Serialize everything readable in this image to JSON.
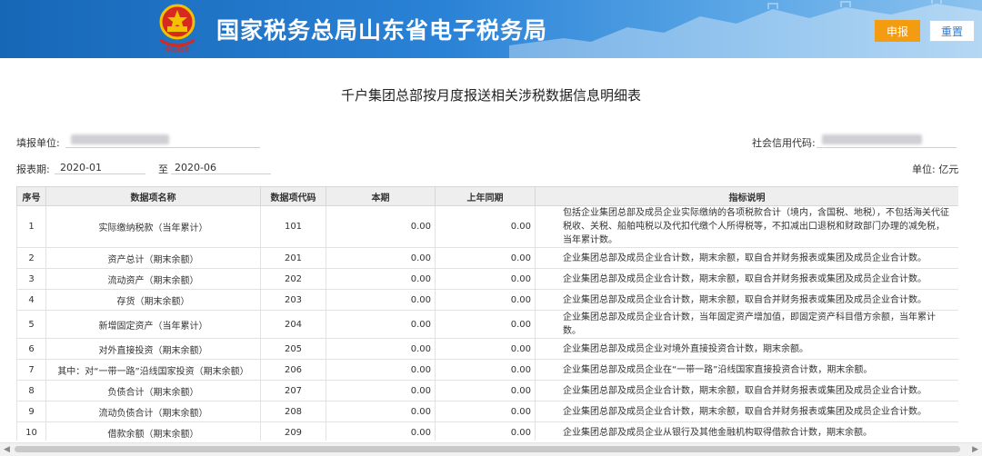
{
  "header": {
    "site_title": "国家税务总局山东省电子税务局",
    "submit_label": "申报",
    "reset_label": "重置"
  },
  "form": {
    "title": "千户集团总部按月度报送相关涉税数据信息明细表",
    "filler_label": "填报单位:",
    "credit_code_label": "社会信用代码:",
    "period_label": "报表期:",
    "period_start": "2020-01",
    "period_to": "至",
    "period_end": "2020-06",
    "unit_label": "单位: 亿元"
  },
  "table": {
    "headers": [
      "序号",
      "数据项名称",
      "数据项代码",
      "本期",
      "上年同期",
      "指标说明"
    ],
    "rows": [
      {
        "no": "1",
        "name": "实际缴纳税款（当年累计）",
        "code": "101",
        "cur": "0.00",
        "prev": "0.00",
        "desc": "包括企业集团总部及成员企业实际缴纳的各项税款合计（境内，含国税、地税），不包括海关代征税收、关税、船舶吨税以及代扣代缴个人所得税等，不扣减出口退税和财政部门办理的减免税，当年累计数。"
      },
      {
        "no": "2",
        "name": "资产总计（期末余额）",
        "code": "201",
        "cur": "0.00",
        "prev": "0.00",
        "desc": "企业集团总部及成员企业合计数，期末余额，取自合并财务报表或集团及成员企业合计数。"
      },
      {
        "no": "3",
        "name": "流动资产（期末余额）",
        "code": "202",
        "cur": "0.00",
        "prev": "0.00",
        "desc": "企业集团总部及成员企业合计数，期末余额，取自合并财务报表或集团及成员企业合计数。"
      },
      {
        "no": "4",
        "name": "存货（期末余额）",
        "code": "203",
        "cur": "0.00",
        "prev": "0.00",
        "desc": "企业集团总部及成员企业合计数，期末余额，取自合并财务报表或集团及成员企业合计数。"
      },
      {
        "no": "5",
        "name": "新增固定资产（当年累计）",
        "code": "204",
        "cur": "0.00",
        "prev": "0.00",
        "desc": "企业集团总部及成员企业合计数，当年固定资产增加值，即固定资产科目借方余额，当年累计数。"
      },
      {
        "no": "6",
        "name": "对外直接投资（期末余额）",
        "code": "205",
        "cur": "0.00",
        "prev": "0.00",
        "desc": "企业集团总部及成员企业对境外直接投资合计数，期末余额。"
      },
      {
        "no": "7",
        "name": "其中：对“一带一路”沿线国家投资（期末余额）",
        "code": "206",
        "cur": "0.00",
        "prev": "0.00",
        "desc": "企业集团总部及成员企业在“一带一路”沿线国家直接投资合计数，期末余额。"
      },
      {
        "no": "8",
        "name": "负债合计（期末余额）",
        "code": "207",
        "cur": "0.00",
        "prev": "0.00",
        "desc": "企业集团总部及成员企业合计数，期末余额，取自合并财务报表或集团及成员企业合计数。"
      },
      {
        "no": "9",
        "name": "流动负债合计（期末余额）",
        "code": "208",
        "cur": "0.00",
        "prev": "0.00",
        "desc": "企业集团总部及成员企业合计数，期末余额，取自合并财务报表或集团及成员企业合计数。"
      },
      {
        "no": "10",
        "name": "借款余额（期末余额）",
        "code": "209",
        "cur": "0.00",
        "prev": "0.00",
        "desc": "企业集团总部及成员企业从银行及其他金融机构取得借款合计数，期末余额。"
      }
    ]
  },
  "colors": {
    "header_blue": "#1767b7",
    "submit_orange": "#f39c12",
    "reset_text_blue": "#2a7cd3"
  },
  "icons": {
    "emblem": "national-emblem-icon",
    "scroll_left": "chevron-left-icon",
    "scroll_right": "chevron-right-icon"
  }
}
